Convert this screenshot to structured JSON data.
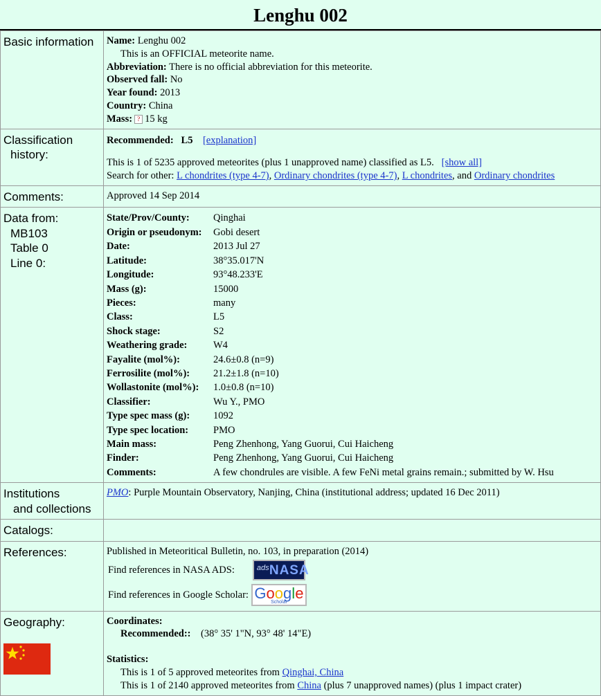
{
  "title": "Lenghu 002",
  "basic": {
    "label": "Basic information",
    "name_k": "Name:",
    "name_v": "Lenghu 002",
    "official": "This is an OFFICIAL meteorite name.",
    "abbr_k": "Abbreviation:",
    "abbr_v": "There is no official abbreviation for this meteorite.",
    "fall_k": "Observed fall:",
    "fall_v": "No",
    "year_k": "Year found:",
    "year_v": "2013",
    "country_k": "Country:",
    "country_v": "China",
    "mass_k": "Mass:",
    "mass_v": "15 kg",
    "help_icon": "?"
  },
  "classification": {
    "label1": "Classification",
    "label2": "history:",
    "rec_k": "Recommended:",
    "rec_v": "L5",
    "explanation": "[explanation]",
    "count_text": "This is 1 of 5235 approved meteorites (plus 1 unapproved name) classified as L5.",
    "show_all": "[show all]",
    "search_prefix": "Search for other:",
    "link1": "L chondrites (type 4-7)",
    "link2": "Ordinary chondrites (type 4-7)",
    "link3": "L chondrites",
    "and": ", and",
    "link4": "Ordinary chondrites"
  },
  "comments": {
    "label": "Comments:",
    "value": "Approved 14 Sep 2014"
  },
  "datafrom": {
    "label1": "Data from:",
    "label2": "MB103",
    "label3": "Table 0",
    "label4": "Line 0:",
    "rows": [
      {
        "k": "State/Prov/County:",
        "v": "Qinghai"
      },
      {
        "k": "Origin or pseudonym:",
        "v": "Gobi desert"
      },
      {
        "k": "Date:",
        "v": "2013 Jul 27"
      },
      {
        "k": "Latitude:",
        "v": "38°35.017'N"
      },
      {
        "k": "Longitude:",
        "v": "93°48.233'E"
      },
      {
        "k": "Mass (g):",
        "v": "15000"
      },
      {
        "k": "Pieces:",
        "v": "many"
      },
      {
        "k": "Class:",
        "v": "L5"
      },
      {
        "k": "Shock stage:",
        "v": "S2"
      },
      {
        "k": "Weathering grade:",
        "v": "W4"
      },
      {
        "k": "Fayalite (mol%):",
        "v": "24.6±0.8 (n=9)"
      },
      {
        "k": "Ferrosilite (mol%):",
        "v": "21.2±1.8 (n=10)"
      },
      {
        "k": "Wollastonite (mol%):",
        "v": "1.0±0.8 (n=10)"
      },
      {
        "k": "Classifier:",
        "v": "Wu Y., PMO"
      },
      {
        "k": "Type spec mass (g):",
        "v": "1092"
      },
      {
        "k": "Type spec location:",
        "v": "PMO"
      },
      {
        "k": "Main mass:",
        "v": "Peng Zhenhong, Yang Guorui, Cui Haicheng"
      },
      {
        "k": "Finder:",
        "v": "Peng Zhenhong, Yang Guorui, Cui Haicheng"
      },
      {
        "k": "Comments:",
        "v": "A few chondrules are visible. A few FeNi metal grains remain.; submitted by W. Hsu"
      }
    ]
  },
  "institutions": {
    "label1": "Institutions",
    "label2": "and collections",
    "link": "PMO",
    "text": ": Purple Mountain Observatory, Nanjing, China (institutional address; updated 16 Dec 2011)"
  },
  "catalogs": {
    "label": "Catalogs:"
  },
  "references": {
    "label": "References:",
    "published": "Published in Meteoritical Bulletin, no. 103, in preparation (2014)",
    "nasa_text": "Find references in NASA ADS:",
    "nasa_logo_small": "ads",
    "nasa_logo_big": "NASA",
    "google_text": "Find references in Google Scholar:",
    "google_logo": "Google",
    "google_sub": "Scholar"
  },
  "geography": {
    "label": "Geography:",
    "coords_k": "Coordinates:",
    "rec_k": "Recommended::",
    "rec_v": "(38° 35' 1\"N, 93° 48' 14\"E)",
    "stats_k": "Statistics:",
    "stat1_prefix": "This is 1 of 5 approved meteorites from",
    "stat1_link": "Qinghai, China",
    "stat2_prefix": "This is 1 of 2140 approved meteorites from",
    "stat2_link": "China",
    "stat2_suffix": "(plus 7 unapproved names) (plus 1 impact crater)"
  },
  "colors": {
    "background": "#e0fff0",
    "link": "#1a33cc",
    "flag_red": "#de2910",
    "flag_star": "#ffde00"
  }
}
